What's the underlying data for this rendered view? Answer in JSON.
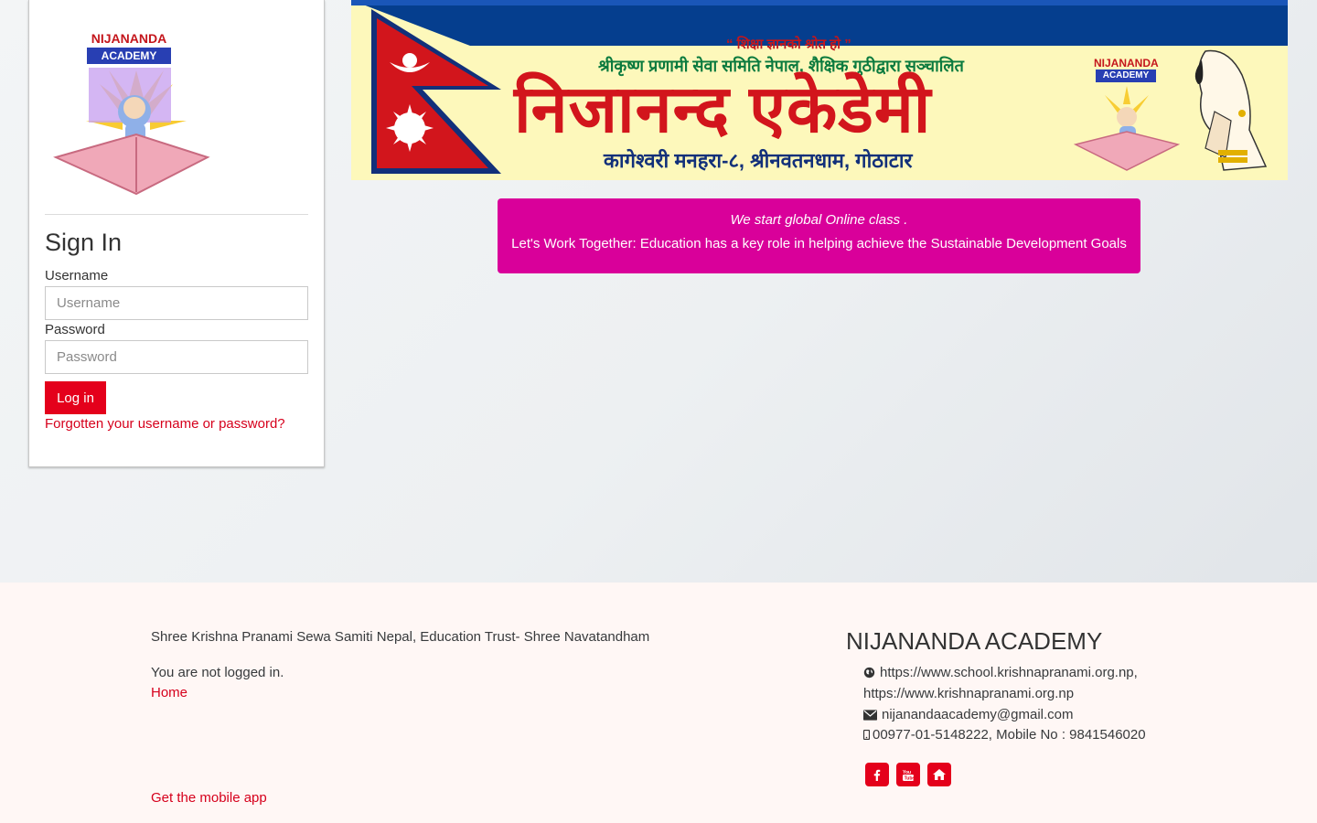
{
  "login": {
    "logo_title": "NIJANANDA",
    "logo_subtitle": "ACADEMY",
    "heading": "Sign In",
    "username_label": "Username",
    "username_placeholder": "Username",
    "password_label": "Password",
    "password_placeholder": "Password",
    "login_button": "Log in",
    "forgot_link": "Forgotten your username or password?"
  },
  "banner": {
    "line1": "“ शिक्षा ज्ञानको श्रोत हो ”",
    "line2": "श्रीकृष्ण प्रणामी सेवा समिति नेपाल, शैक्षिक गुठीद्वारा सञ्चालित",
    "title": "निजानन्द एकेडेमी",
    "address": "कागेश्वरी मनहरा-८, श्रीनवतनधाम, गोठाटार",
    "logo_title": "NIJANANDA",
    "logo_subtitle": "ACADEMY"
  },
  "notice": {
    "line1": "We start global Online class .",
    "line2": "Let's Work Together: Education has a key role in helping achieve the Sustainable Development Goals"
  },
  "footer": {
    "trust": "Shree Krishna Pranami Sewa Samiti Nepal, Education Trust- Shree Navatandham",
    "logged_status": "You are not logged in.",
    "home_link": "Home",
    "mobile_app_link": "Get the mobile app",
    "title": "NIJANANDA ACADEMY",
    "website_line1": "https://www.school.krishnapranami.org.np,",
    "website_line2": "https://www.krishnapranami.org.np",
    "email": "nijanandaacademy@gmail.com",
    "phone": "00977-01-5148222, Mobile No : 9841546020",
    "social_icons": [
      "facebook-icon",
      "youtube-icon",
      "home-icon"
    ]
  },
  "colors": {
    "accent": "#e4001b",
    "notice_bg": "#d9009a",
    "footer_bg": "#fff7f5",
    "link": "#d6001c"
  }
}
